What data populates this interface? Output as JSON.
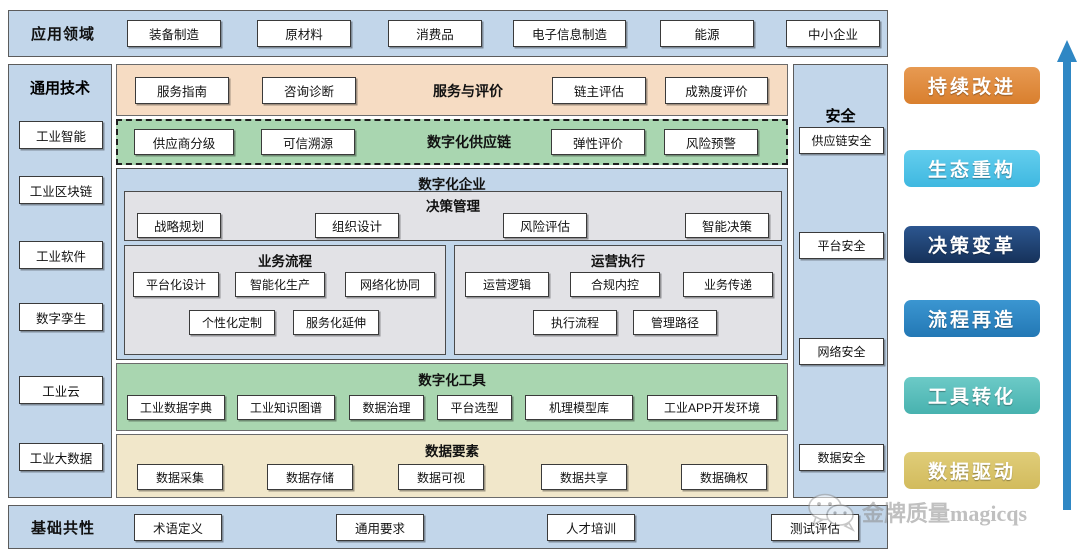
{
  "colors": {
    "band_blue": "#c2d6ea",
    "service_peach": "#f6dcc3",
    "supply_green": "#a9d6b0",
    "tools_green": "#a9d6b0",
    "data_cream": "#f1e7ca",
    "panel_gray": "#e2e2e6",
    "badge_orange": "#e08b3c",
    "badge_cyan": "#4ec3e8",
    "badge_navy": "#1f3f6e",
    "badge_blue": "#2f87c4",
    "badge_teal": "#58c0bd",
    "badge_gold": "#d9c46a",
    "arrow_blue": "#2f87c4"
  },
  "application_domain": {
    "label": "应用领域",
    "items": [
      {
        "label": "装备制造"
      },
      {
        "label": "原材料"
      },
      {
        "label": "消费品"
      },
      {
        "label": "电子信息制造"
      },
      {
        "label": "能源"
      },
      {
        "label": "中小企业"
      }
    ]
  },
  "general_technology": {
    "label": "通用技术",
    "items": [
      {
        "label": "工业智能"
      },
      {
        "label": "工业区块链"
      },
      {
        "label": "工业软件"
      },
      {
        "label": "数字孪生"
      },
      {
        "label": "工业云"
      },
      {
        "label": "工业大数据"
      }
    ]
  },
  "security": {
    "label": "安全",
    "items": [
      {
        "label": "供应链安全"
      },
      {
        "label": "平台安全"
      },
      {
        "label": "网络安全"
      },
      {
        "label": "数据安全"
      }
    ]
  },
  "service_evaluation": {
    "title": "服务与评价",
    "left_items": [
      {
        "label": "服务指南"
      },
      {
        "label": "咨询诊断"
      }
    ],
    "right_items": [
      {
        "label": "链主评估"
      },
      {
        "label": "成熟度评价"
      }
    ]
  },
  "digital_supply_chain": {
    "title": "数字化供应链",
    "left_items": [
      {
        "label": "供应商分级"
      },
      {
        "label": "可信溯源"
      }
    ],
    "right_items": [
      {
        "label": "弹性评价"
      },
      {
        "label": "风险预警"
      }
    ]
  },
  "digital_enterprise": {
    "title": "数字化企业",
    "decision_management": {
      "title": "决策管理",
      "items": [
        {
          "label": "战略规划"
        },
        {
          "label": "组织设计"
        },
        {
          "label": "风险评估"
        },
        {
          "label": "智能决策"
        }
      ]
    },
    "business_process": {
      "title": "业务流程",
      "row1": [
        {
          "label": "平台化设计"
        },
        {
          "label": "智能化生产"
        },
        {
          "label": "网络化协同"
        }
      ],
      "row2": [
        {
          "label": "个性化定制"
        },
        {
          "label": "服务化延伸"
        }
      ]
    },
    "operations_execution": {
      "title": "运营执行",
      "row1": [
        {
          "label": "运营逻辑"
        },
        {
          "label": "合规内控"
        },
        {
          "label": "业务传递"
        }
      ],
      "row2": [
        {
          "label": "执行流程"
        },
        {
          "label": "管理路径"
        }
      ]
    }
  },
  "digital_tools": {
    "title": "数字化工具",
    "items": [
      {
        "label": "工业数据字典"
      },
      {
        "label": "工业知识图谱"
      },
      {
        "label": "数据治理"
      },
      {
        "label": "平台选型"
      },
      {
        "label": "机理模型库"
      },
      {
        "label": "工业APP开发环境"
      }
    ]
  },
  "data_elements": {
    "title": "数据要素",
    "items": [
      {
        "label": "数据采集"
      },
      {
        "label": "数据存储"
      },
      {
        "label": "数据可视"
      },
      {
        "label": "数据共享"
      },
      {
        "label": "数据确权"
      }
    ]
  },
  "basic_commonality": {
    "label": "基础共性",
    "items": [
      {
        "label": "术语定义"
      },
      {
        "label": "通用要求"
      },
      {
        "label": "人才培训"
      },
      {
        "label": "测试评估"
      }
    ]
  },
  "maturity_badges": [
    {
      "label": "持续改进",
      "color": "#e08b3c"
    },
    {
      "label": "生态重构",
      "color": "#4ec3e8"
    },
    {
      "label": "决策变革",
      "color": "#1f3f6e"
    },
    {
      "label": "流程再造",
      "color": "#2f87c4"
    },
    {
      "label": "工具转化",
      "color": "#58c0bd"
    },
    {
      "label": "数据驱动",
      "color": "#d9c46a"
    }
  ],
  "watermark": {
    "text": "金牌质量magicqs",
    "icon": "wechat-bubbles-icon"
  }
}
